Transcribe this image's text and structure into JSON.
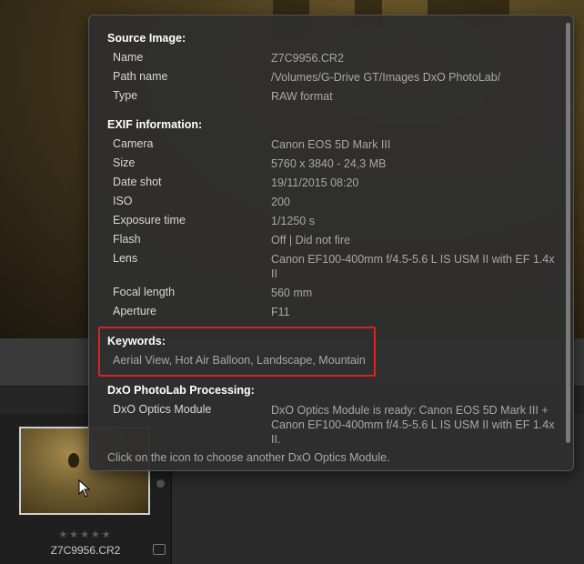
{
  "info_panel": {
    "source": {
      "title": "Source Image:",
      "rows": [
        {
          "label": "Name",
          "value": "Z7C9956.CR2"
        },
        {
          "label": "Path name",
          "value": "/Volumes/G-Drive GT/Images DxO PhotoLab/"
        },
        {
          "label": "Type",
          "value": "RAW format"
        }
      ]
    },
    "exif": {
      "title": "EXIF information:",
      "rows": [
        {
          "label": "Camera",
          "value": "Canon EOS 5D Mark III"
        },
        {
          "label": "Size",
          "value": "5760 x 3840 - 24,3 MB"
        },
        {
          "label": "Date shot",
          "value": "19/11/2015 08:20"
        },
        {
          "label": "ISO",
          "value": "200"
        },
        {
          "label": "Exposure time",
          "value": "1/1250 s"
        },
        {
          "label": "Flash",
          "value": "Off | Did not fire"
        },
        {
          "label": "Lens",
          "value": "Canon EF100-400mm f/4.5-5.6 L IS USM II with EF 1.4x II"
        },
        {
          "label": "Focal length",
          "value": "560 mm"
        },
        {
          "label": "Aperture",
          "value": "F11"
        }
      ]
    },
    "keywords": {
      "title": "Keywords:",
      "value": "Aerial View, Hot Air Balloon, Landscape, Mountain"
    },
    "processing": {
      "title": "DxO PhotoLab Processing:",
      "rows": [
        {
          "label": "DxO Optics Module",
          "value": "DxO Optics Module is ready: Canon EOS 5D Mark III + Canon EF100-400mm f/4.5-5.6 L IS USM II with EF 1.4x II."
        }
      ],
      "hint": "Click on the icon to choose another DxO Optics Module."
    }
  },
  "filmstrip": {
    "thumbnail_name": "Z7C9956.CR2",
    "rating_stars": "★★★★★",
    "rating": 0
  },
  "colors": {
    "highlight": "#e02020",
    "panel_bg": "#2e2e2e"
  }
}
